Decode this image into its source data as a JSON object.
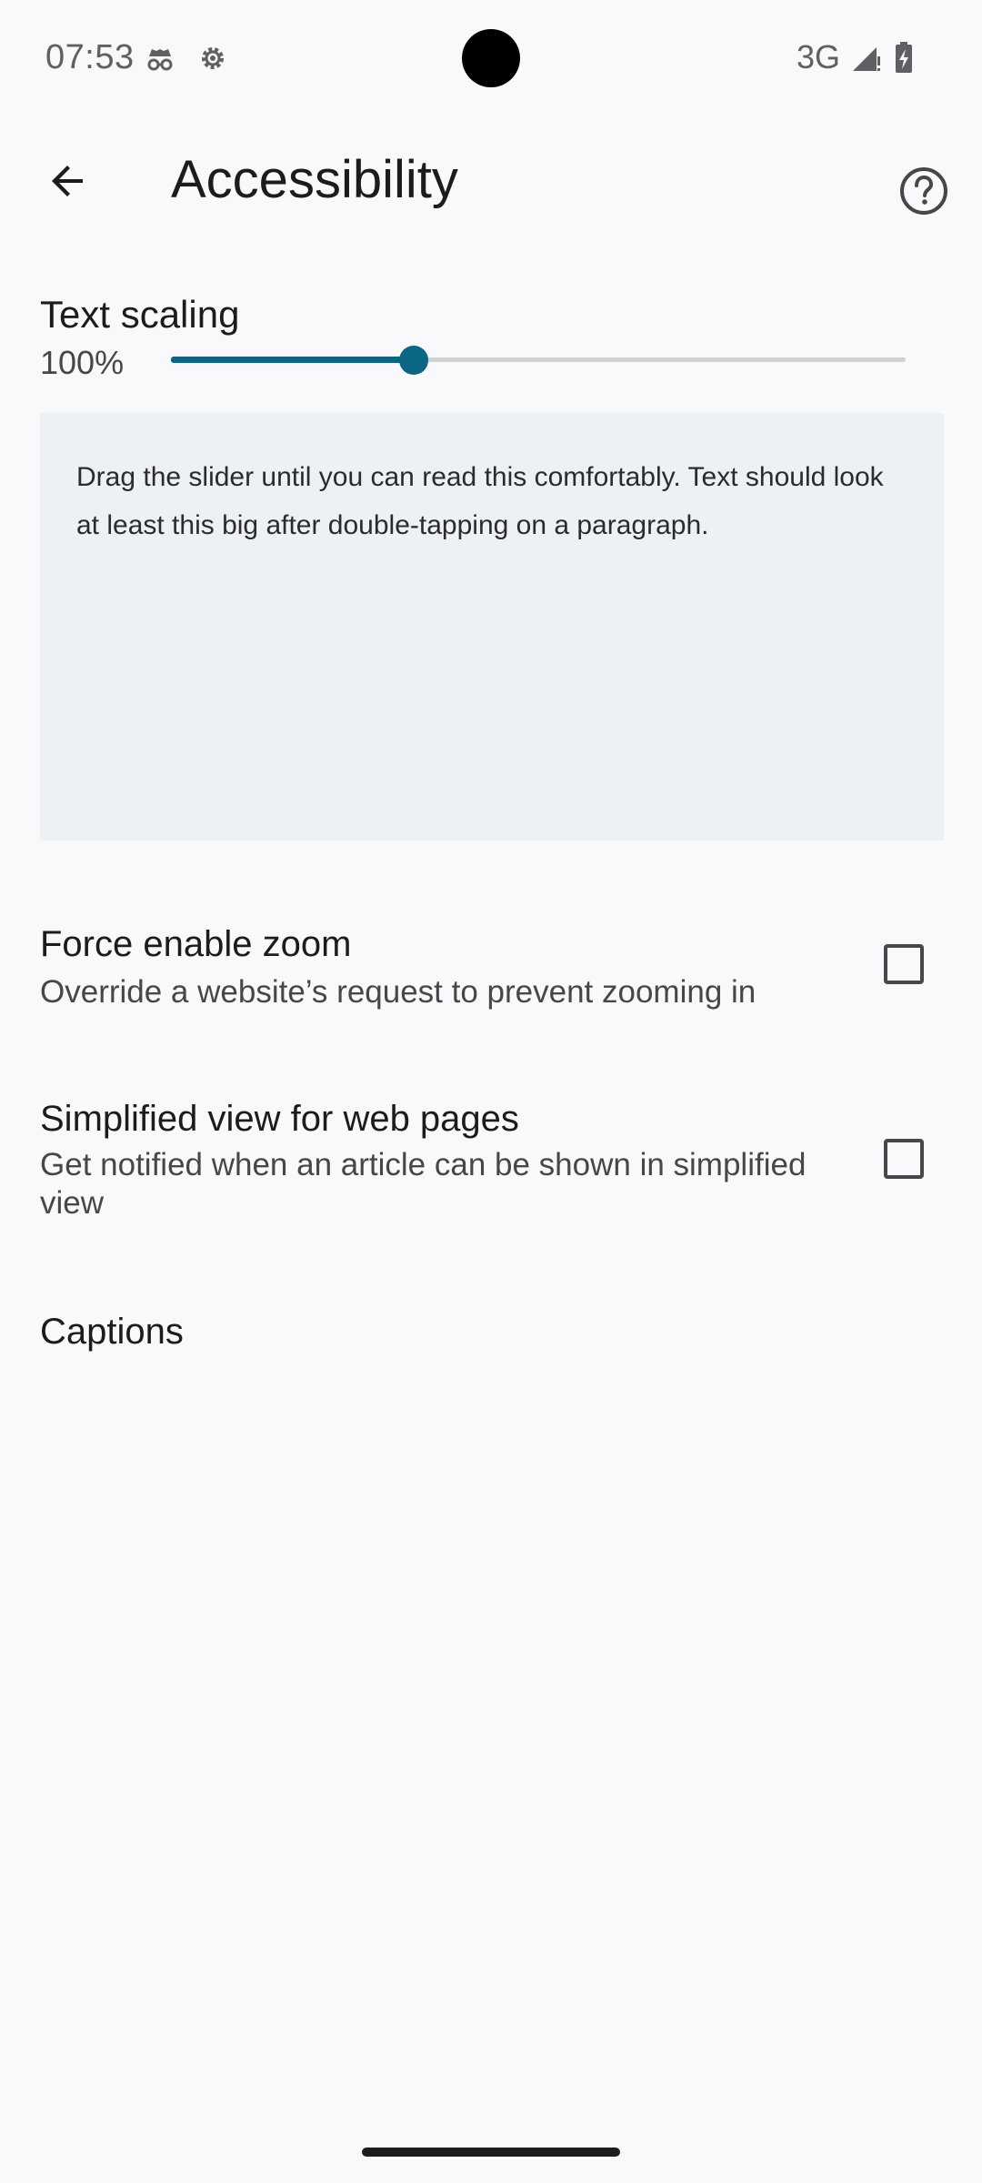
{
  "status_bar": {
    "time": "07:53",
    "icons": [
      "incognito-icon",
      "settings-gear-icon"
    ],
    "network": "3G",
    "signal_icon": "signal-icon",
    "battery_icon": "battery-charging-icon"
  },
  "app_bar": {
    "back_icon": "arrow-left-icon",
    "title": "Accessibility",
    "help_icon": "help-circle-icon"
  },
  "text_scaling": {
    "heading": "Text scaling",
    "percent": "100%",
    "slider_fraction": 0.33,
    "preview_text": "Drag the slider until you can read this comfortably. Text should look at least this big after double-tapping on a paragraph."
  },
  "settings": [
    {
      "title": "Force enable zoom",
      "subtitle": "Override a website’s request to prevent zooming in",
      "checked": false
    },
    {
      "title": "Simplified view for web pages",
      "subtitle": "Get notified when an article can be shown in simplified view",
      "checked": false
    },
    {
      "title": "Captions"
    }
  ],
  "colors": {
    "accent": "#0a6683",
    "background": "#f9f9fc",
    "preview_background": "#eef1f4"
  }
}
